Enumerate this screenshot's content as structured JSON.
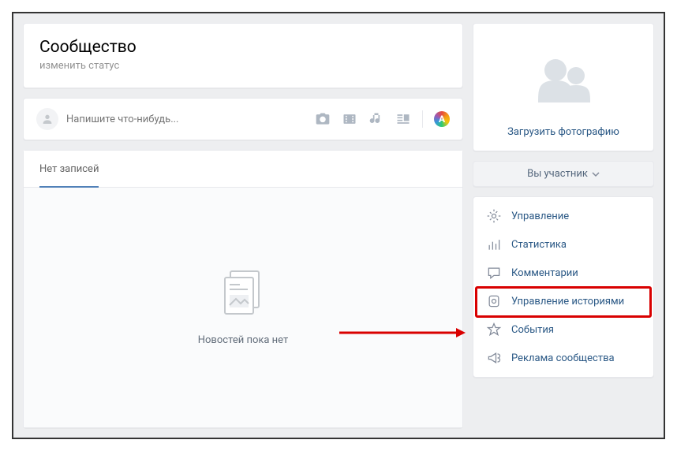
{
  "header": {
    "title": "Сообщество",
    "status": "изменить статус"
  },
  "composer": {
    "placeholder": "Напишите что-нибудь..."
  },
  "feed": {
    "tab_label": "Нет записей",
    "empty_text": "Новостей пока нет"
  },
  "sidebar": {
    "upload_label": "Загрузить фотографию",
    "role_button": "Вы участник",
    "menu": [
      {
        "label": "Управление"
      },
      {
        "label": "Статистика"
      },
      {
        "label": "Комментарии"
      },
      {
        "label": "Управление историями"
      },
      {
        "label": "События"
      },
      {
        "label": "Реклама сообщества"
      }
    ]
  }
}
